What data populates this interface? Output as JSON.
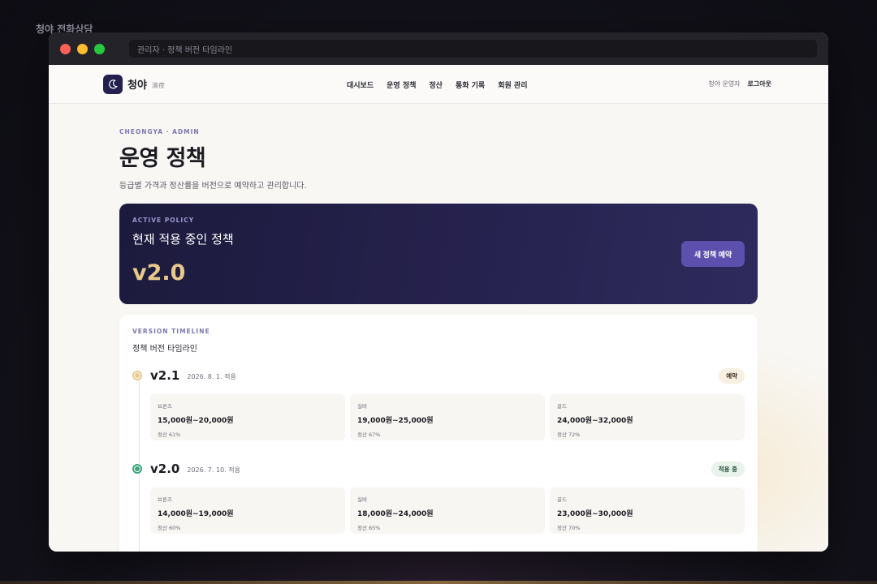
{
  "app_label": "청야 전화상담",
  "browser": {
    "url": "관리자 · 정책 버전 타임라인"
  },
  "nav": {
    "logo_name": "청야",
    "logo_sub": "清夜",
    "links": [
      "대시보드",
      "운영 정책",
      "정산",
      "통화 기록",
      "회원 관리"
    ],
    "user": "청야 운영자",
    "logout": "로그아웃"
  },
  "header": {
    "eyebrow": "CHEONGYA · ADMIN",
    "title": "운영 정책",
    "description": "등급별 가격과 정산률을 버전으로 예약하고 관리합니다."
  },
  "active_policy": {
    "eyebrow": "ACTIVE POLICY",
    "title": "현재 적용 중인 정책",
    "version": "v2.0",
    "button": "새 정책 예약"
  },
  "timeline": {
    "eyebrow": "VERSION TIMELINE",
    "title": "정책 버전 타임라인",
    "versions": [
      {
        "version": "v2.1",
        "date": "2026. 8. 1. 적용",
        "status": "예약",
        "status_color": "#e8c98a",
        "tiers": [
          {
            "name": "브론즈",
            "price": "15,000원~20,000원",
            "settle": "정산 61%"
          },
          {
            "name": "실버",
            "price": "19,000원~25,000원",
            "settle": "정산 67%"
          },
          {
            "name": "골드",
            "price": "24,000원~32,000원",
            "settle": "정산 72%"
          }
        ]
      },
      {
        "version": "v2.0",
        "date": "2026. 7. 10. 적용",
        "status": "적용 중",
        "status_color": "#3aa57a",
        "tiers": [
          {
            "name": "브론즈",
            "price": "14,000원~19,000원",
            "settle": "정산 60%"
          },
          {
            "name": "실버",
            "price": "18,000원~24,000원",
            "settle": "정산 65%"
          },
          {
            "name": "골드",
            "price": "23,000원~30,000원",
            "settle": "정산 70%"
          }
        ]
      }
    ]
  }
}
